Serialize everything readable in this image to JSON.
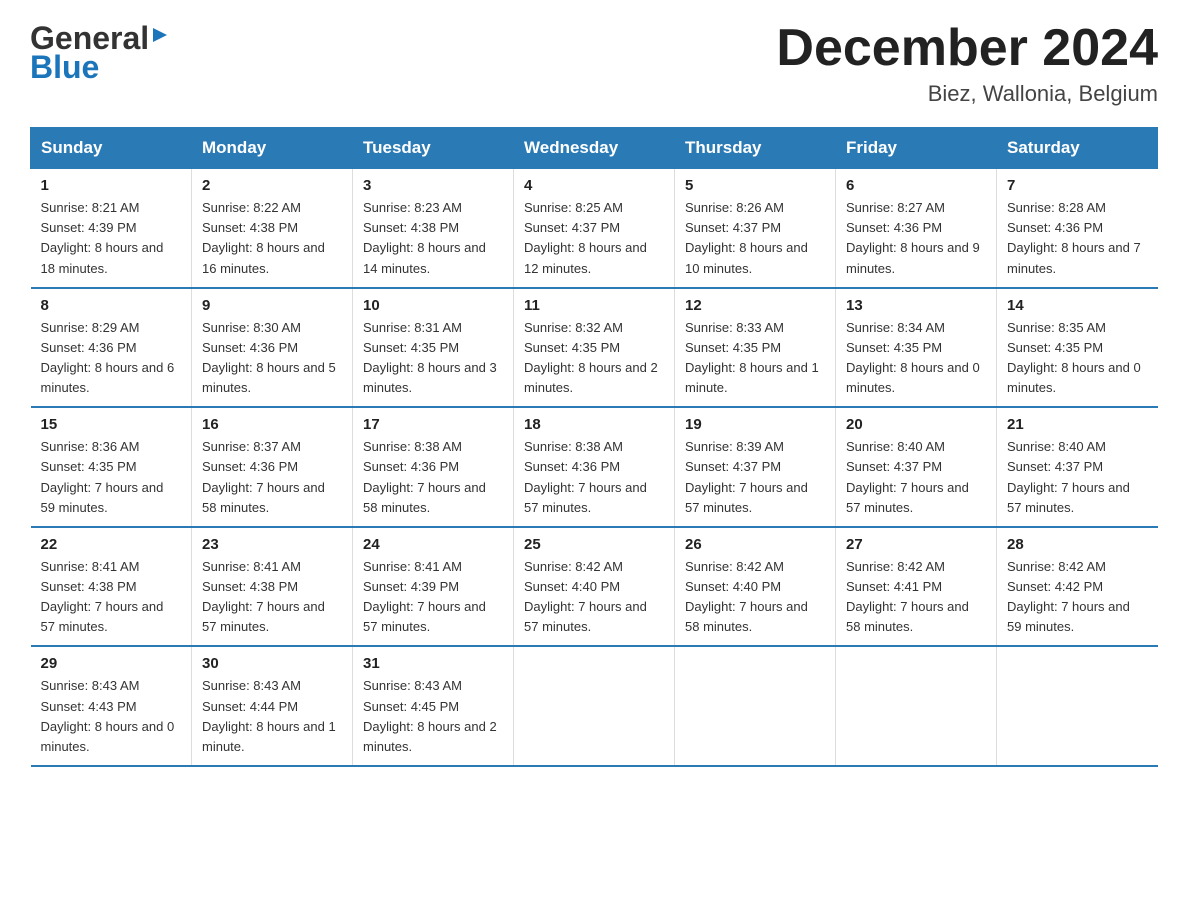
{
  "header": {
    "month_title": "December 2024",
    "location": "Biez, Wallonia, Belgium",
    "logo_general": "General",
    "logo_blue": "Blue"
  },
  "days_of_week": [
    "Sunday",
    "Monday",
    "Tuesday",
    "Wednesday",
    "Thursday",
    "Friday",
    "Saturday"
  ],
  "weeks": [
    [
      {
        "day": "1",
        "sunrise": "8:21 AM",
        "sunset": "4:39 PM",
        "daylight": "8 hours and 18 minutes."
      },
      {
        "day": "2",
        "sunrise": "8:22 AM",
        "sunset": "4:38 PM",
        "daylight": "8 hours and 16 minutes."
      },
      {
        "day": "3",
        "sunrise": "8:23 AM",
        "sunset": "4:38 PM",
        "daylight": "8 hours and 14 minutes."
      },
      {
        "day": "4",
        "sunrise": "8:25 AM",
        "sunset": "4:37 PM",
        "daylight": "8 hours and 12 minutes."
      },
      {
        "day": "5",
        "sunrise": "8:26 AM",
        "sunset": "4:37 PM",
        "daylight": "8 hours and 10 minutes."
      },
      {
        "day": "6",
        "sunrise": "8:27 AM",
        "sunset": "4:36 PM",
        "daylight": "8 hours and 9 minutes."
      },
      {
        "day": "7",
        "sunrise": "8:28 AM",
        "sunset": "4:36 PM",
        "daylight": "8 hours and 7 minutes."
      }
    ],
    [
      {
        "day": "8",
        "sunrise": "8:29 AM",
        "sunset": "4:36 PM",
        "daylight": "8 hours and 6 minutes."
      },
      {
        "day": "9",
        "sunrise": "8:30 AM",
        "sunset": "4:36 PM",
        "daylight": "8 hours and 5 minutes."
      },
      {
        "day": "10",
        "sunrise": "8:31 AM",
        "sunset": "4:35 PM",
        "daylight": "8 hours and 3 minutes."
      },
      {
        "day": "11",
        "sunrise": "8:32 AM",
        "sunset": "4:35 PM",
        "daylight": "8 hours and 2 minutes."
      },
      {
        "day": "12",
        "sunrise": "8:33 AM",
        "sunset": "4:35 PM",
        "daylight": "8 hours and 1 minute."
      },
      {
        "day": "13",
        "sunrise": "8:34 AM",
        "sunset": "4:35 PM",
        "daylight": "8 hours and 0 minutes."
      },
      {
        "day": "14",
        "sunrise": "8:35 AM",
        "sunset": "4:35 PM",
        "daylight": "8 hours and 0 minutes."
      }
    ],
    [
      {
        "day": "15",
        "sunrise": "8:36 AM",
        "sunset": "4:35 PM",
        "daylight": "7 hours and 59 minutes."
      },
      {
        "day": "16",
        "sunrise": "8:37 AM",
        "sunset": "4:36 PM",
        "daylight": "7 hours and 58 minutes."
      },
      {
        "day": "17",
        "sunrise": "8:38 AM",
        "sunset": "4:36 PM",
        "daylight": "7 hours and 58 minutes."
      },
      {
        "day": "18",
        "sunrise": "8:38 AM",
        "sunset": "4:36 PM",
        "daylight": "7 hours and 57 minutes."
      },
      {
        "day": "19",
        "sunrise": "8:39 AM",
        "sunset": "4:37 PM",
        "daylight": "7 hours and 57 minutes."
      },
      {
        "day": "20",
        "sunrise": "8:40 AM",
        "sunset": "4:37 PM",
        "daylight": "7 hours and 57 minutes."
      },
      {
        "day": "21",
        "sunrise": "8:40 AM",
        "sunset": "4:37 PM",
        "daylight": "7 hours and 57 minutes."
      }
    ],
    [
      {
        "day": "22",
        "sunrise": "8:41 AM",
        "sunset": "4:38 PM",
        "daylight": "7 hours and 57 minutes."
      },
      {
        "day": "23",
        "sunrise": "8:41 AM",
        "sunset": "4:38 PM",
        "daylight": "7 hours and 57 minutes."
      },
      {
        "day": "24",
        "sunrise": "8:41 AM",
        "sunset": "4:39 PM",
        "daylight": "7 hours and 57 minutes."
      },
      {
        "day": "25",
        "sunrise": "8:42 AM",
        "sunset": "4:40 PM",
        "daylight": "7 hours and 57 minutes."
      },
      {
        "day": "26",
        "sunrise": "8:42 AM",
        "sunset": "4:40 PM",
        "daylight": "7 hours and 58 minutes."
      },
      {
        "day": "27",
        "sunrise": "8:42 AM",
        "sunset": "4:41 PM",
        "daylight": "7 hours and 58 minutes."
      },
      {
        "day": "28",
        "sunrise": "8:42 AM",
        "sunset": "4:42 PM",
        "daylight": "7 hours and 59 minutes."
      }
    ],
    [
      {
        "day": "29",
        "sunrise": "8:43 AM",
        "sunset": "4:43 PM",
        "daylight": "8 hours and 0 minutes."
      },
      {
        "day": "30",
        "sunrise": "8:43 AM",
        "sunset": "4:44 PM",
        "daylight": "8 hours and 1 minute."
      },
      {
        "day": "31",
        "sunrise": "8:43 AM",
        "sunset": "4:45 PM",
        "daylight": "8 hours and 2 minutes."
      },
      null,
      null,
      null,
      null
    ]
  ],
  "labels": {
    "sunrise": "Sunrise:",
    "sunset": "Sunset:",
    "daylight": "Daylight:"
  }
}
